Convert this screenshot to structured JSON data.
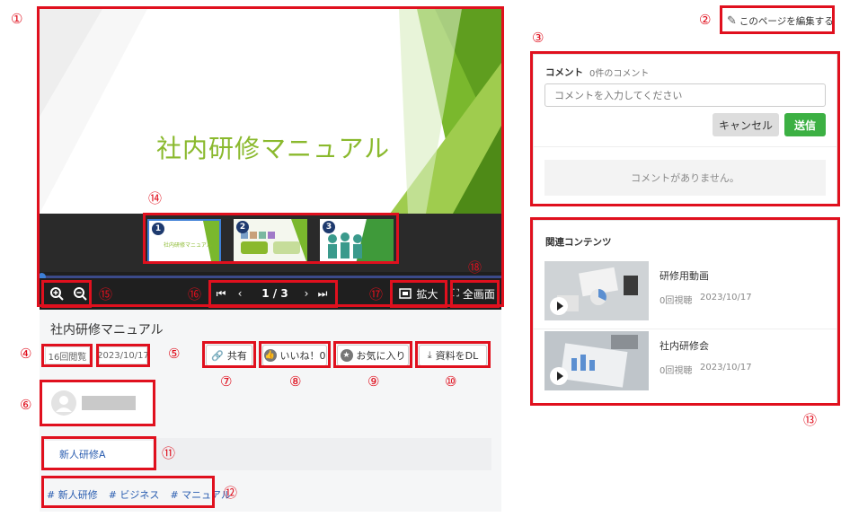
{
  "annotations": {
    "n1": "①",
    "n2": "②",
    "n3": "③",
    "n4": "④",
    "n5": "⑤",
    "n6": "⑥",
    "n7": "⑦",
    "n8": "⑧",
    "n9": "⑨",
    "n10": "⑩",
    "n11": "⑪",
    "n12": "⑫",
    "n13": "⑬",
    "n14": "⑭",
    "n15": "⑮",
    "n16": "⑯",
    "n17": "⑰",
    "n18": "⑱"
  },
  "edit_page": {
    "label": "このページを編集する",
    "icon": "pencil-icon"
  },
  "slide": {
    "title": "社内研修マニュアル",
    "accent": "#8ab92d"
  },
  "thumbnails": [
    {
      "badge": "1",
      "caption": "社内研修マニュアル"
    },
    {
      "badge": "2"
    },
    {
      "badge": "3"
    }
  ],
  "controls": {
    "zoom_in_icon": "zoom-in-icon",
    "zoom_out_icon": "zoom-out-icon",
    "page_indicator": "1 / 3",
    "expand_label": "拡大",
    "fullscreen_label": "全画面"
  },
  "document": {
    "title": "社内研修マニュアル",
    "views": "16回閲覧",
    "date": "2023/10/17"
  },
  "actions": {
    "share": "共有",
    "like": "いいね！0",
    "favorite": "お気に入り",
    "download": "資料をDL"
  },
  "category": "新人研修A",
  "tags": [
    "# 新人研修",
    "# ビジネス",
    "# マニュアル"
  ],
  "comments": {
    "header": "コメント",
    "count": "0件のコメント",
    "placeholder": "コメントを入力してください",
    "cancel": "キャンセル",
    "submit": "送信",
    "empty": "コメントがありません。"
  },
  "related": {
    "header": "関連コンテンツ",
    "items": [
      {
        "title": "研修用動画",
        "views": "0回視聴",
        "date": "2023/10/17"
      },
      {
        "title": "社内研修会",
        "views": "0回視聴",
        "date": "2023/10/17"
      }
    ]
  },
  "colors": {
    "annotation_red": "#e0101e",
    "green": "#3cb043",
    "link_blue": "#2a5db0"
  }
}
